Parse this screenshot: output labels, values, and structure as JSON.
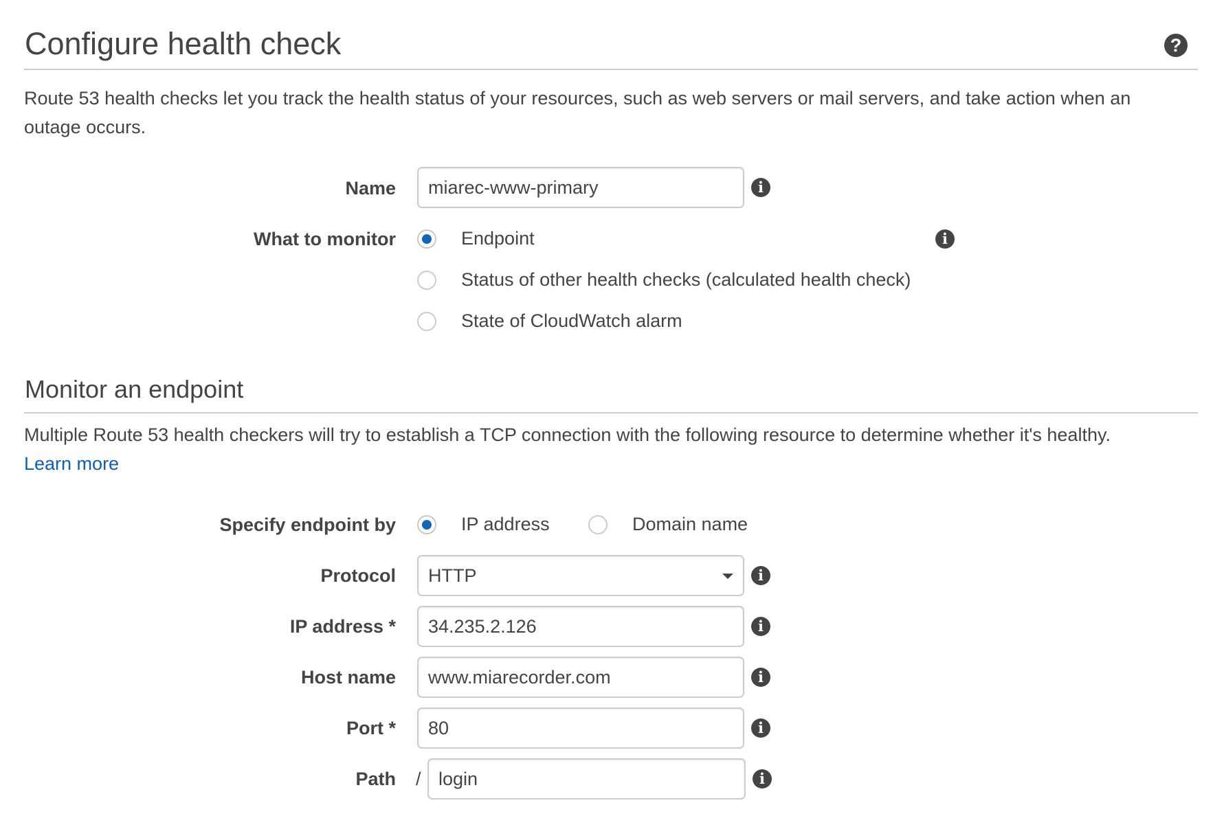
{
  "header": {
    "title": "Configure health check",
    "help_icon": "question-circle-icon",
    "description": "Route 53 health checks let you track the health status of your resources, such as web servers or mail servers, and take action when an outage occurs."
  },
  "general": {
    "name": {
      "label": "Name",
      "value": "miarec-www-primary"
    },
    "what_to_monitor": {
      "label": "What to monitor",
      "options": [
        {
          "label": "Endpoint",
          "selected": true
        },
        {
          "label": "Status of other health checks (calculated health check)",
          "selected": false
        },
        {
          "label": "State of CloudWatch alarm",
          "selected": false
        }
      ]
    }
  },
  "endpoint_section": {
    "title": "Monitor an endpoint",
    "description": "Multiple Route 53 health checkers will try to establish a TCP connection with the following resource to determine whether it's healthy.",
    "learn_more": "Learn more",
    "specify_by": {
      "label": "Specify endpoint by",
      "options": [
        {
          "label": "IP address",
          "selected": true
        },
        {
          "label": "Domain name",
          "selected": false
        }
      ]
    },
    "protocol": {
      "label": "Protocol",
      "value": "HTTP"
    },
    "ip_address": {
      "label": "IP address *",
      "value": "34.235.2.126"
    },
    "host_name": {
      "label": "Host name",
      "value": "www.miarecorder.com"
    },
    "port": {
      "label": "Port *",
      "value": "80"
    },
    "path": {
      "label": "Path",
      "prefix": "/",
      "value": "login"
    }
  },
  "icons": {
    "info": "info-circle-icon"
  },
  "colors": {
    "accent": "#1166bb",
    "link": "#0f5eb4",
    "text": "#444444",
    "border": "#cccccc"
  }
}
